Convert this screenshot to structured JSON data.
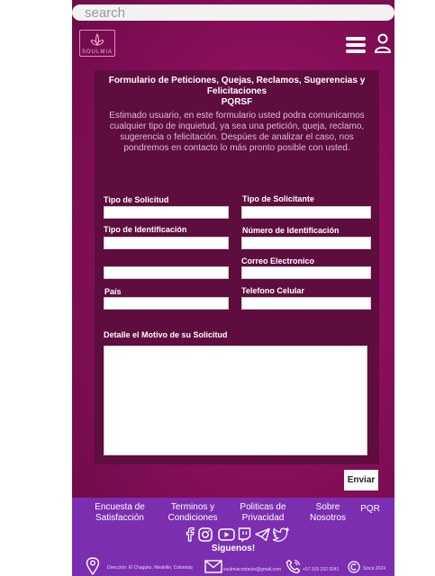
{
  "search": {
    "placeholder": "search"
  },
  "brand": {
    "logo_text": "SOULMIA"
  },
  "form": {
    "title": "Formulario de Peticiones, Quejas, Reclamos, Sugerencias y Felicitaciones",
    "subtitle": "PQRSF",
    "description": "Estimado usuario, en este formulario usted podra comunicarnos cualquier tipo de inquietud, ya sea una petición, queja, reclamo, sugerencia o felicitación. Despúes de analizar el caso, nos pondremos en contacto lo más pronto posible con usted.",
    "labels": {
      "tipo_solicitud": "Tipo de Solicitud",
      "tipo_solicitante": "Tipo de Solicitante",
      "tipo_identificacion": "Tipo de Identificación",
      "numero_identificacion": "Número de Identificación",
      "correo": "Correo Electronico",
      "pais": "País",
      "telefono": "Telefono Celular",
      "detalle": "Detalle el Motivo de su Solicitud"
    },
    "submit_label": "Enviar"
  },
  "footer": {
    "links": {
      "encuesta": "Encuesta de Satisfacción",
      "terminos": "Terminos y Condiciones",
      "politicas": "Politicas de Privacidad",
      "sobre": "Sobre Nosotros",
      "pqr": "PQR"
    },
    "follow": "Siguenos!",
    "address": "Dirección: El Chaguito, Medellin, Colombia",
    "email": "soulmiacontacto@gmail.com",
    "phone": "+57 315 232 9241",
    "since": "Since 2024"
  }
}
